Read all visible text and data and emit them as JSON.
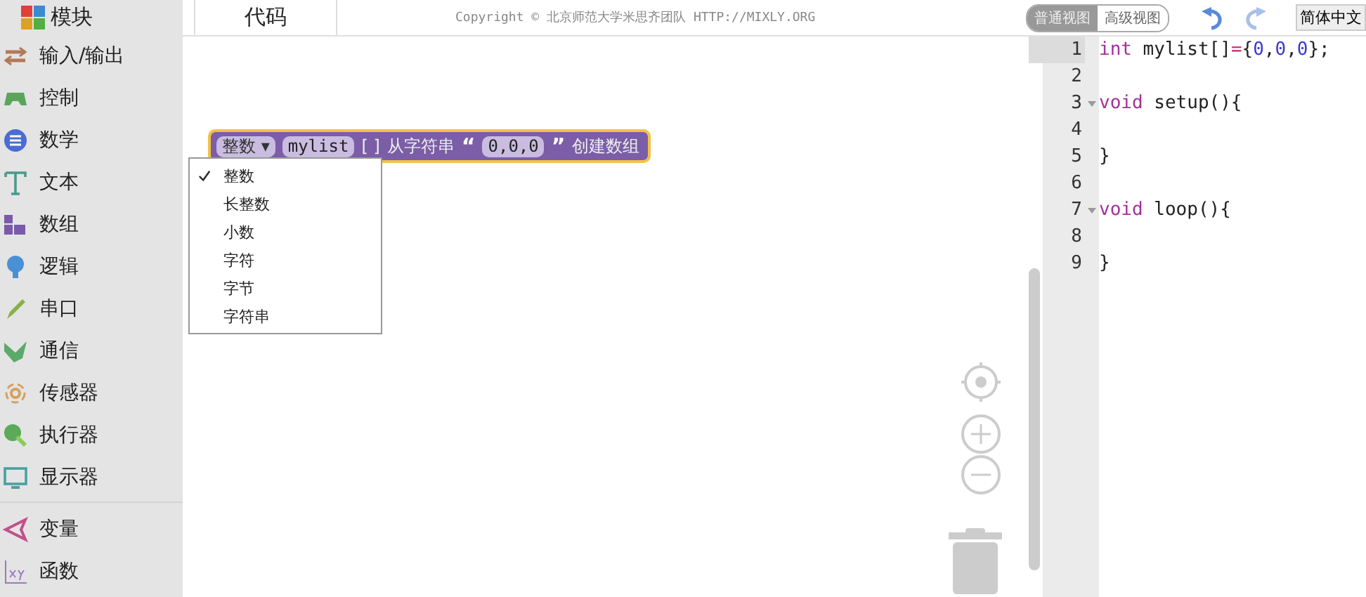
{
  "sidebar": {
    "title": "模块",
    "category_groups": [
      [
        {
          "label": "输入/输出"
        },
        {
          "label": "控制"
        },
        {
          "label": "数学"
        },
        {
          "label": "文本"
        },
        {
          "label": "数组"
        },
        {
          "label": "逻辑"
        },
        {
          "label": "串口"
        },
        {
          "label": "通信"
        },
        {
          "label": "传感器"
        },
        {
          "label": "执行器"
        },
        {
          "label": "显示器"
        }
      ],
      [
        {
          "label": "变量"
        },
        {
          "label": "函数"
        }
      ]
    ]
  },
  "header": {
    "tab": "代码",
    "copyright": "Copyright © 北京师范大学米思齐团队 HTTP://MIXLY.ORG",
    "views": [
      {
        "label": "普通视图",
        "selected": true
      },
      {
        "label": "高级视图",
        "selected": false
      }
    ],
    "language": "简体中文"
  },
  "block": {
    "type_dropdown": "整数 ▾",
    "variable": "mylist",
    "brackets": "[ ]",
    "text_from": "从字符串",
    "open_quote": "“",
    "string_value": "0,0,0",
    "close_quote": "”",
    "text_create": "创建数组",
    "selected": true
  },
  "dropdown_menu": [
    {
      "label": "整数",
      "selected": true
    },
    {
      "label": "长整数",
      "selected": false
    },
    {
      "label": "小数",
      "selected": false
    },
    {
      "label": "字符",
      "selected": false
    },
    {
      "label": "字节",
      "selected": false
    },
    {
      "label": "字符串",
      "selected": false
    }
  ],
  "code_editor": {
    "lines": [
      {
        "number": "1",
        "active": true,
        "fold": false,
        "tokens": [
          {
            "kind": "keyword",
            "text": "int"
          },
          {
            "kind": "plain",
            "text": " mylist[]"
          },
          {
            "kind": "operator",
            "text": "="
          },
          {
            "kind": "plain",
            "text": "{"
          },
          {
            "kind": "number",
            "text": "0"
          },
          {
            "kind": "plain",
            "text": ","
          },
          {
            "kind": "number",
            "text": "0"
          },
          {
            "kind": "plain",
            "text": ","
          },
          {
            "kind": "number",
            "text": "0"
          },
          {
            "kind": "plain",
            "text": "};"
          }
        ]
      },
      {
        "number": "2",
        "active": false,
        "fold": false
      },
      {
        "number": "3",
        "active": false,
        "fold": true,
        "tokens": [
          {
            "kind": "keyword",
            "text": "void"
          },
          {
            "kind": "plain",
            "text": " setup(){"
          }
        ]
      },
      {
        "number": "4",
        "active": false,
        "fold": false
      },
      {
        "number": "5",
        "active": false,
        "fold": false,
        "tokens": [
          {
            "kind": "plain",
            "text": "}"
          }
        ]
      },
      {
        "number": "6",
        "active": false,
        "fold": false
      },
      {
        "number": "7",
        "active": false,
        "fold": true,
        "tokens": [
          {
            "kind": "keyword",
            "text": "void"
          },
          {
            "kind": "plain",
            "text": " loop(){"
          }
        ]
      },
      {
        "number": "8",
        "active": false,
        "fold": false
      },
      {
        "number": "9",
        "active": false,
        "fold": false,
        "tokens": [
          {
            "kind": "plain",
            "text": "}"
          }
        ]
      }
    ]
  }
}
